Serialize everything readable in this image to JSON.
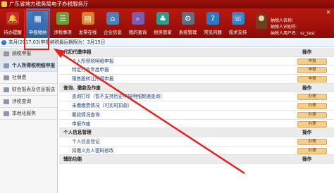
{
  "window": {
    "title": "广东省地方税务局电子办税服务厅"
  },
  "toolbar": {
    "items": [
      {
        "label": "待办提醒",
        "icon": "bell-icon",
        "color": "#c9302c",
        "glyph": "🔔"
      },
      {
        "label": "申报缴纳",
        "icon": "calculator-icon",
        "color": "#3d6fb5",
        "glyph": "▦",
        "active": true
      },
      {
        "label": "涉税事项",
        "icon": "documents-icon",
        "color": "#6c9e3a",
        "glyph": "☰"
      },
      {
        "label": "发票在线",
        "icon": "invoice-icon",
        "color": "#d9812a",
        "glyph": "▤"
      },
      {
        "label": "企业信息",
        "icon": "building-icon",
        "color": "#4f7fb8",
        "glyph": "⌂"
      },
      {
        "label": "我的查询",
        "icon": "search-icon",
        "color": "#7d5cb0",
        "glyph": "⌕"
      },
      {
        "label": "税务管家",
        "icon": "housekeeper-icon",
        "color": "#2f9a8c",
        "glyph": "♣"
      },
      {
        "label": "系统管理",
        "icon": "gear-icon",
        "color": "#5f6f82",
        "glyph": "⚙"
      },
      {
        "label": "常见问题",
        "icon": "help-icon",
        "color": "#2b7bc7",
        "glyph": "?"
      },
      {
        "label": "技术支持",
        "icon": "support-icon",
        "color": "#3a83c9",
        "glyph": "☏"
      }
    ]
  },
  "user": {
    "line1": "纳税人名称：",
    "line2": "纳税人识别号：",
    "line3": "纳税人用户名：sz_test",
    "close_glyph": "✕"
  },
  "notice": {
    "icon_glyph": "i",
    "text": "本月(2017.03)申报纳税最后期限为：3月15日"
  },
  "sidebar": {
    "items": [
      {
        "label": "纳税申报",
        "kind": "header"
      },
      {
        "label": "个人所得税明细申报",
        "kind": "active"
      },
      {
        "label": "社保费",
        "kind": "normal"
      },
      {
        "label": "财会报表及信息报送",
        "kind": "normal"
      },
      {
        "label": "涉税查询",
        "kind": "normal"
      },
      {
        "label": "本地化服务",
        "kind": "normal"
      }
    ]
  },
  "main": {
    "rows": [
      {
        "type": "cat",
        "label": "代扣代缴申报",
        "op": "操作"
      },
      {
        "type": "item",
        "label": "个人所得税明细申报",
        "button": "申报"
      },
      {
        "type": "item",
        "label": "特定行业年度申报",
        "button": "申报"
      },
      {
        "type": "item",
        "label": "限售股转让所得申报",
        "button": "申报"
      },
      {
        "type": "cat",
        "label": "查询、撤款及作废",
        "op": "操作"
      },
      {
        "type": "item",
        "label": "查询打印（暂不支持历史申报明细数据查询）",
        "button": "办理"
      },
      {
        "type": "item",
        "label": "未缴缴费情况（可实时扣款）",
        "button": "办理"
      },
      {
        "type": "item",
        "label": "撤款情况查询",
        "button": "办理"
      },
      {
        "type": "item",
        "label": "申报作废",
        "button": "办理"
      },
      {
        "type": "cat",
        "label": "个人信息管理",
        "op": "操作"
      },
      {
        "type": "item",
        "label": "个人信息登记",
        "button": "办理"
      },
      {
        "type": "item",
        "label": "扣缴义务人密码修改",
        "button": "办理"
      },
      {
        "type": "cat",
        "label": "辅助功能",
        "op": "操作"
      }
    ]
  },
  "annotation": {
    "color": "#e8201a"
  }
}
